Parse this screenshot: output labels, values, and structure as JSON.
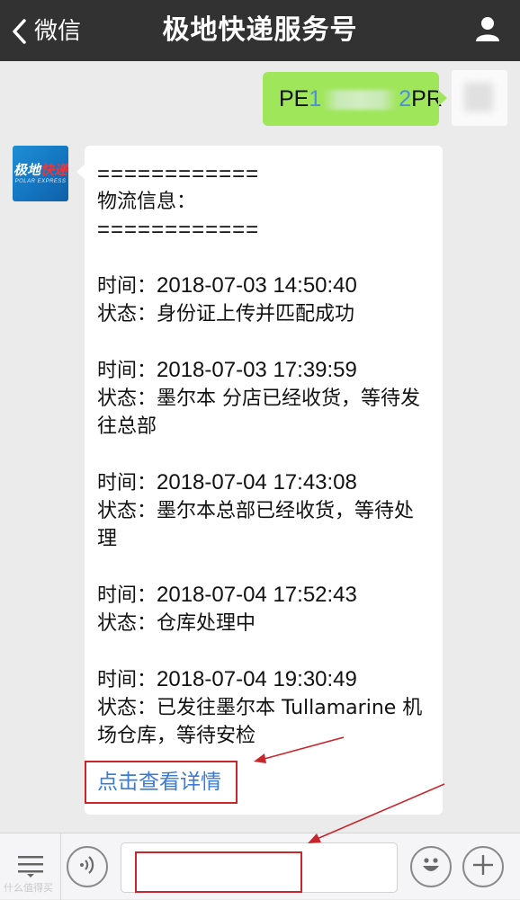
{
  "header": {
    "back_label": "微信",
    "title": "极地快递服务号"
  },
  "sent_message": {
    "prefix": "PE1",
    "suffix": "2PR"
  },
  "avatar_logo": {
    "main_white": "极地",
    "main_red": "快递",
    "sub": "POLAR EXPRESS"
  },
  "received_message": {
    "separator_top": "============",
    "heading": "物流信息：",
    "separator_bottom": "============",
    "entries": [
      {
        "time_label": "时间：",
        "time": "2018-07-03 14:50:40",
        "status_label": "状态：",
        "status": "身份证上传并匹配成功"
      },
      {
        "time_label": "时间：",
        "time": "2018-07-03 17:39:59",
        "status_label": "状态：",
        "status": "墨尔本 分店已经收货，等待发往总部"
      },
      {
        "time_label": "时间：",
        "time": "2018-07-04 17:43:08",
        "status_label": "状态：",
        "status": "墨尔本总部已经收货，等待处理"
      },
      {
        "time_label": "时间：",
        "time": "2018-07-04 17:52:43",
        "status_label": "状态：",
        "status": "仓库处理中"
      },
      {
        "time_label": "时间：",
        "time": "2018-07-04 19:30:49",
        "status_label": "状态：",
        "status": "已发往墨尔本 Tullamarine 机场仓库，等待安检"
      }
    ],
    "link_text": "点击查看详情"
  },
  "input_bar": {
    "text_value": ""
  },
  "watermark": {
    "text": "什么值得买"
  },
  "colors": {
    "header_bg": "#323232",
    "sent_bubble": "#9fe65a",
    "link": "#3a7bd5",
    "annotation_red": "#c8262c"
  },
  "icons": {
    "back": "chevron-left-icon",
    "profile": "person-icon",
    "menu": "menu-list-icon",
    "voice": "voice-icon",
    "emoji": "emoji-icon",
    "plus": "plus-icon"
  }
}
